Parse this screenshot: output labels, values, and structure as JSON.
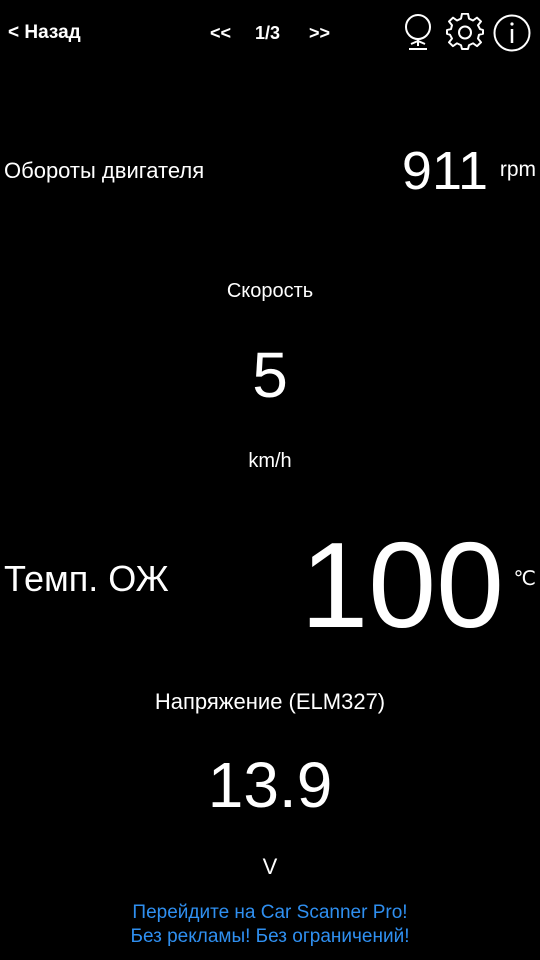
{
  "topbar": {
    "back_label": "< Назад",
    "prev_label": "<<",
    "page_indicator": "1/3",
    "next_label": ">>",
    "icons": [
      "microphone-icon",
      "gear-icon",
      "info-icon"
    ]
  },
  "gauges": {
    "rpm": {
      "label": "Обороты двигателя",
      "value": "911",
      "unit": "rpm"
    },
    "speed": {
      "label": "Скорость",
      "value": "5",
      "unit": "km/h"
    },
    "coolant_temp": {
      "label": "Темп. ОЖ",
      "value": "100",
      "unit": "℃"
    },
    "voltage": {
      "label": "Напряжение (ELM327)",
      "value": "13.9",
      "unit": "V"
    }
  },
  "promo": {
    "line1": "Перейдите на Car Scanner Pro!",
    "line2": "Без рекламы! Без ограничений!"
  },
  "colors": {
    "background": "#000000",
    "text": "#ffffff",
    "promo_link": "#2f8ff0"
  }
}
